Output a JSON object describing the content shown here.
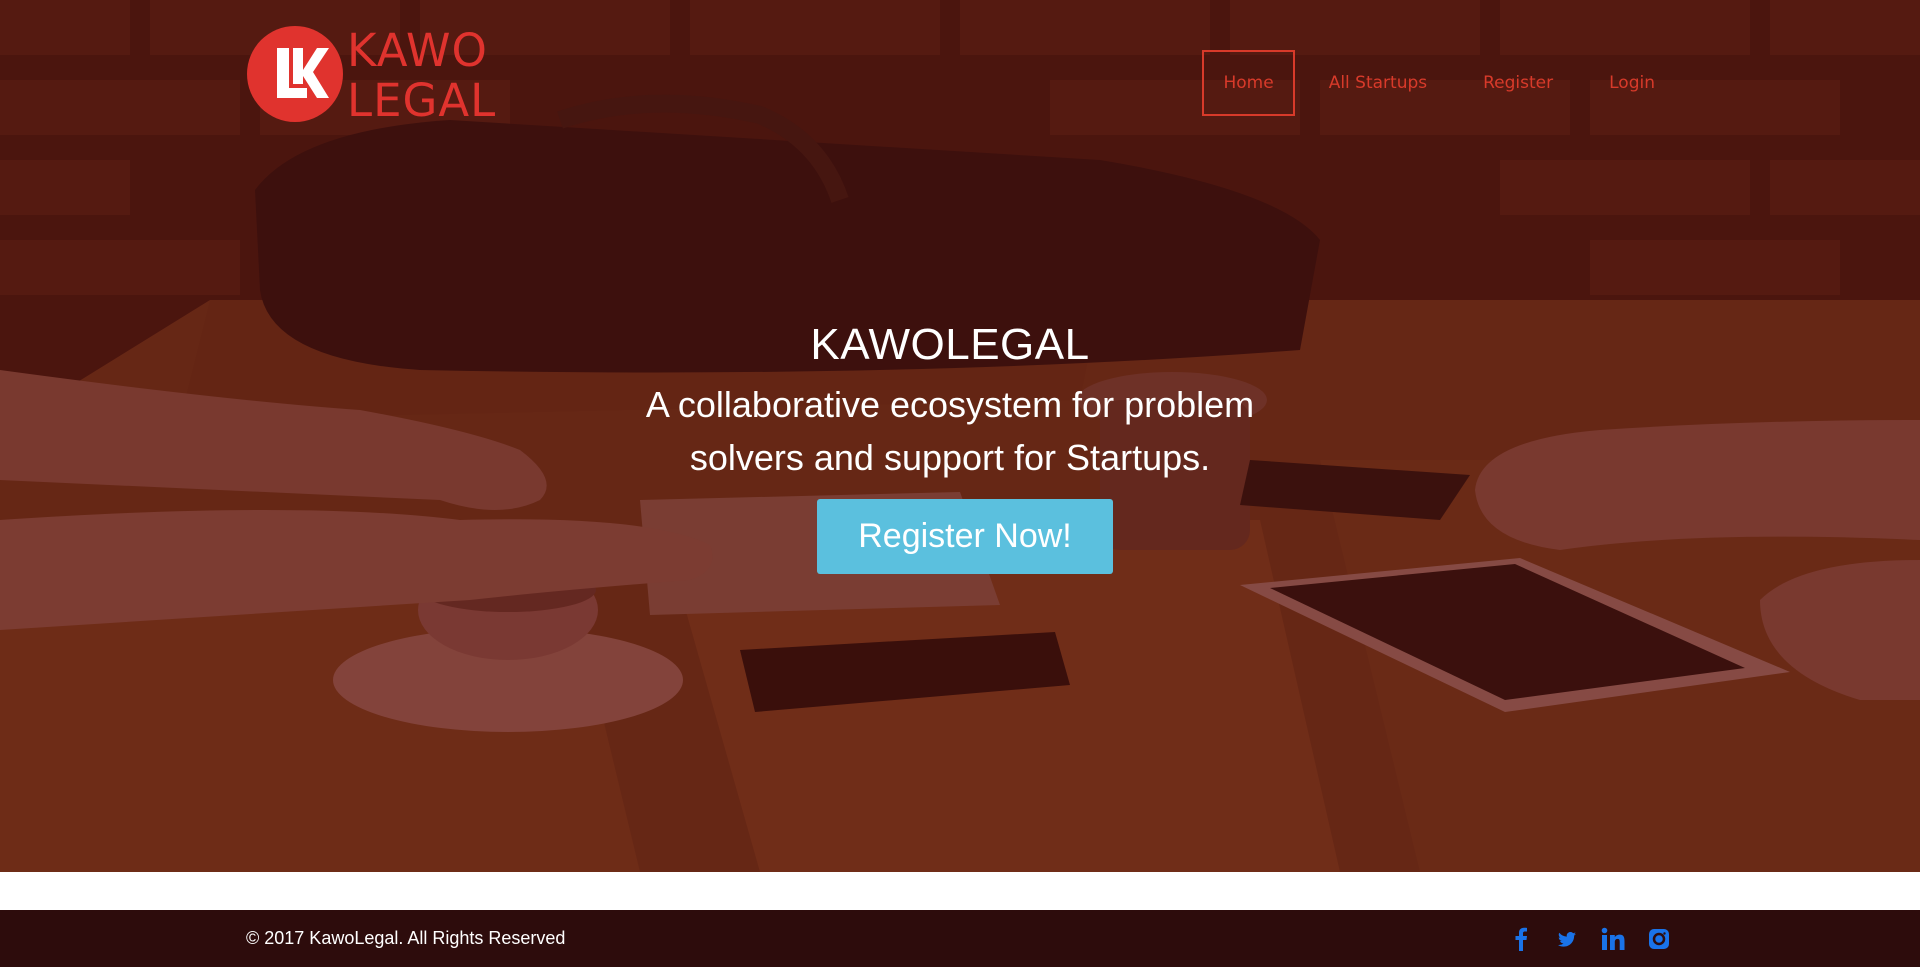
{
  "brand": {
    "logo_line1": "KAWO",
    "logo_line2": "LEGAL",
    "logo_mark": "LK",
    "brand_color": "#e0332e"
  },
  "nav": {
    "items": [
      {
        "label": "Home",
        "active": true
      },
      {
        "label": "All Startups",
        "active": false
      },
      {
        "label": "Register",
        "active": false
      },
      {
        "label": "Login",
        "active": false
      }
    ]
  },
  "hero": {
    "title": "KAWOLEGAL",
    "subtitle": "A collaborative ecosystem for problem solvers and support for Startups.",
    "cta_label": "Register Now!",
    "cta_color": "#5bc0de",
    "overlay_color": "#4a1c14"
  },
  "footer": {
    "copyright": "© 2017 KawoLegal. All Rights Reserved",
    "background": "#2d0c0c",
    "social": [
      "facebook-icon",
      "twitter-icon",
      "linkedin-icon",
      "instagram-icon"
    ],
    "social_color": "#1a73e8"
  }
}
